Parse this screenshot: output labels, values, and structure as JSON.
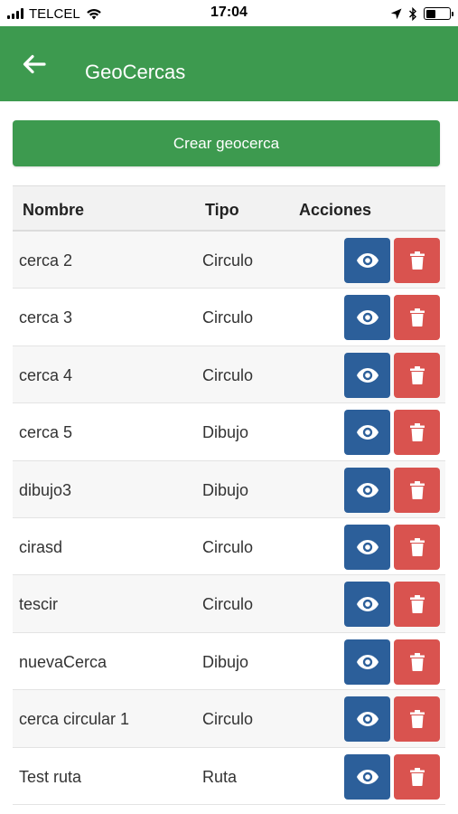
{
  "status_bar": {
    "carrier": "TELCEL",
    "time": "17:04"
  },
  "header": {
    "title": "GeoCercas",
    "back_icon": "arrow-left-icon"
  },
  "create_button_label": "Crear geocerca",
  "colors": {
    "primary_green": "#3d9a4f",
    "view_blue": "#2c5f9a",
    "delete_red": "#d9534f"
  },
  "table": {
    "columns": [
      "Nombre",
      "Tipo",
      "Acciones"
    ],
    "rows": [
      {
        "name": "cerca 2",
        "type": "Circulo"
      },
      {
        "name": "cerca 3",
        "type": "Circulo"
      },
      {
        "name": "cerca 4",
        "type": "Circulo"
      },
      {
        "name": "cerca 5",
        "type": "Dibujo"
      },
      {
        "name": "dibujo3",
        "type": "Dibujo"
      },
      {
        "name": "cirasd",
        "type": "Circulo"
      },
      {
        "name": "tescir",
        "type": "Circulo"
      },
      {
        "name": "nuevaCerca",
        "type": "Dibujo"
      },
      {
        "name": "cerca circular 1",
        "type": "Circulo"
      },
      {
        "name": "Test ruta",
        "type": "Ruta"
      }
    ],
    "action_icons": [
      "eye-icon",
      "trash-icon"
    ]
  }
}
